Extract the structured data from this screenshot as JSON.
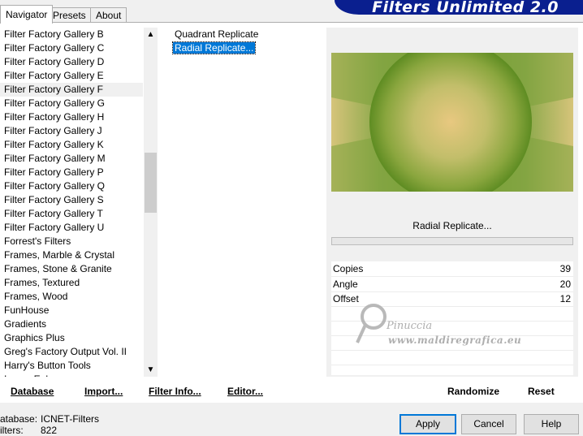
{
  "tabs": [
    {
      "label": "Navigator",
      "active": true
    },
    {
      "label": "Presets",
      "active": false
    },
    {
      "label": "About",
      "active": false
    }
  ],
  "banner_title": "Filters Unlimited 2.0",
  "categories": [
    "Filter Factory Gallery B",
    "Filter Factory Gallery C",
    "Filter Factory Gallery D",
    "Filter Factory Gallery E",
    "Filter Factory Gallery F",
    "Filter Factory Gallery G",
    "Filter Factory Gallery H",
    "Filter Factory Gallery J",
    "Filter Factory Gallery K",
    "Filter Factory Gallery M",
    "Filter Factory Gallery P",
    "Filter Factory Gallery Q",
    "Filter Factory Gallery S",
    "Filter Factory Gallery T",
    "Filter Factory Gallery U",
    "Forrest's Filters",
    "Frames, Marble & Crystal",
    "Frames, Stone & Granite",
    "Frames, Textured",
    "Frames, Wood",
    "FunHouse",
    "Gradients",
    "Graphics Plus",
    "Greg's Factory Output Vol. II",
    "Harry's Button Tools",
    "Image Enhance"
  ],
  "selected_category": "Filter Factory Gallery F",
  "filters": [
    "Quadrant Replicate",
    "Radial Replicate..."
  ],
  "selected_filter": "Radial Replicate...",
  "preview_button": "Radial Replicate...",
  "params": [
    {
      "name": "Copies",
      "value": "39"
    },
    {
      "name": "Angle",
      "value": "20"
    },
    {
      "name": "Offset",
      "value": "12"
    }
  ],
  "watermark": {
    "name": "Pinuccia",
    "url": "www.maldiregrafica.eu"
  },
  "actions": {
    "database": "Database",
    "import": "Import...",
    "filter_info": "Filter Info...",
    "editor": "Editor...",
    "randomize": "Randomize",
    "reset": "Reset"
  },
  "footer": {
    "database_label": "atabase:",
    "database_value": "ICNET-Filters",
    "filters_label": "ilters:",
    "filters_value": "822"
  },
  "buttons": {
    "apply": "Apply",
    "cancel": "Cancel",
    "help": "Help"
  },
  "colors": {
    "selection": "#0078d7",
    "banner": "#0a1f8f",
    "preview_green": "#6a9a2a",
    "preview_gold": "#e2c47a"
  }
}
